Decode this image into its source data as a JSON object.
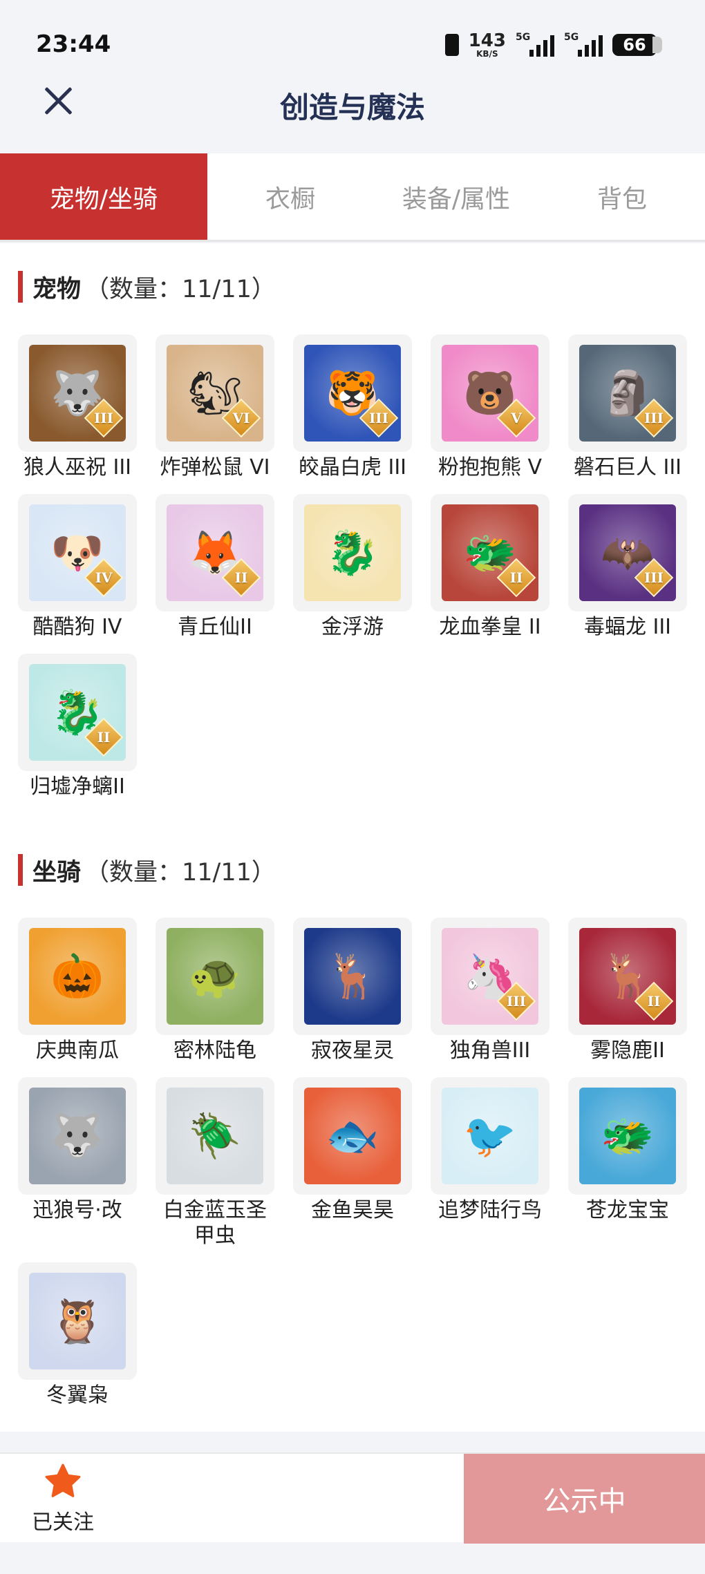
{
  "status_bar": {
    "time": "23:44",
    "net_speed": "143",
    "net_unit": "KB/S",
    "signal1": "5G",
    "signal2": "5G",
    "battery": "66"
  },
  "header": {
    "title": "创造与魔法"
  },
  "tabs": [
    {
      "label": "宠物/坐骑",
      "active": true
    },
    {
      "label": "衣橱"
    },
    {
      "label": "装备/属性"
    },
    {
      "label": "背包"
    }
  ],
  "pets": {
    "title": "宠物",
    "count": "（数量：11/11）",
    "items": [
      {
        "name": "狼人巫祝 III",
        "rank": "III",
        "icon": "wolf-icon",
        "glyph": "🐺",
        "bg": "#8a5a2e"
      },
      {
        "name": "炸弹松鼠 VI",
        "rank": "VI",
        "icon": "squirrel-icon",
        "glyph": "🐿",
        "bg": "#d9b48a"
      },
      {
        "name": "皎晶白虎 III",
        "rank": "III",
        "icon": "tiger-icon",
        "glyph": "🐯",
        "bg": "#2f55b8"
      },
      {
        "name": "粉抱抱熊 V",
        "rank": "V",
        "icon": "bear-icon",
        "glyph": "🐻",
        "bg": "#f08ac8"
      },
      {
        "name": "磐石巨人 III",
        "rank": "III",
        "icon": "golem-icon",
        "glyph": "🗿",
        "bg": "#566878"
      },
      {
        "name": "酷酷狗 IV",
        "rank": "IV",
        "icon": "dog-icon",
        "glyph": "🐶",
        "bg": "#d8e6f5"
      },
      {
        "name": "青丘仙II",
        "rank": "II",
        "icon": "fox-fairy-icon",
        "glyph": "🦊",
        "bg": "#e8c8e6"
      },
      {
        "name": "金浮游",
        "rank": "",
        "icon": "golden-dragon-icon",
        "glyph": "🐉",
        "bg": "#f5e3b0"
      },
      {
        "name": "龙血拳皇 II",
        "rank": "II",
        "icon": "dragon-boxer-icon",
        "glyph": "🐲",
        "bg": "#b8463a"
      },
      {
        "name": "毒蝠龙 III",
        "rank": "III",
        "icon": "bat-dragon-icon",
        "glyph": "🦇",
        "bg": "#5a3082"
      },
      {
        "name": "归墟净螭II",
        "rank": "II",
        "icon": "sea-dragon-icon",
        "glyph": "🐉",
        "bg": "#bde8e6"
      }
    ]
  },
  "mounts": {
    "title": "坐骑",
    "count": "（数量：11/11）",
    "items": [
      {
        "name": "庆典南瓜",
        "rank": "",
        "icon": "pumpkin-icon",
        "glyph": "🎃",
        "bg": "#f0a030"
      },
      {
        "name": "密林陆龟",
        "rank": "",
        "icon": "turtle-icon",
        "glyph": "🐢",
        "bg": "#8fb060"
      },
      {
        "name": "寂夜星灵",
        "rank": "",
        "icon": "star-spirit-icon",
        "glyph": "🦌",
        "bg": "#1d3a8a"
      },
      {
        "name": "独角兽III",
        "rank": "III",
        "icon": "unicorn-icon",
        "glyph": "🦄",
        "bg": "#f2c6dc"
      },
      {
        "name": "雾隐鹿II",
        "rank": "II",
        "icon": "deer-icon",
        "glyph": "🦌",
        "bg": "#a8283a"
      },
      {
        "name": "迅狼号·改",
        "rank": "",
        "icon": "mech-wolf-icon",
        "glyph": "🐺",
        "bg": "#9aa4b0"
      },
      {
        "name": "白金蓝玉圣甲虫",
        "rank": "",
        "icon": "scarab-icon",
        "glyph": "🪲",
        "bg": "#d8dde2"
      },
      {
        "name": "金鱼昊昊",
        "rank": "",
        "icon": "goldfish-icon",
        "glyph": "🐟",
        "bg": "#e8603a"
      },
      {
        "name": "追梦陆行鸟",
        "rank": "",
        "icon": "bird-icon",
        "glyph": "🐦",
        "bg": "#d8eef6"
      },
      {
        "name": "苍龙宝宝",
        "rank": "",
        "icon": "baby-dragon-icon",
        "glyph": "🐲",
        "bg": "#48a8d8"
      },
      {
        "name": "冬翼枭",
        "rank": "",
        "icon": "owl-icon",
        "glyph": "🦉",
        "bg": "#cfd8ee"
      }
    ]
  },
  "bottom_bar": {
    "follow_label": "已关注",
    "publicize_label": "公示中"
  },
  "colors": {
    "accent": "#c73231",
    "publicize_bg": "#e29898",
    "star": "#f05a1a"
  }
}
